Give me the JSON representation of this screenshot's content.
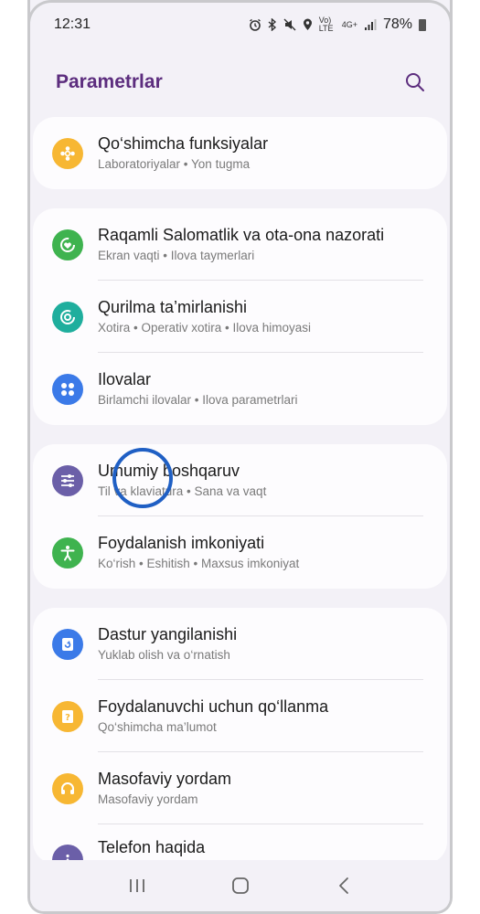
{
  "status_bar": {
    "time": "12:31",
    "network_label": "Vo) LTE",
    "network_type": "4G+",
    "battery_percent": "78%"
  },
  "header": {
    "title": "Parametrlar"
  },
  "groups": [
    {
      "items": [
        {
          "icon": "puzzle-icon",
          "color": "#f7b733",
          "title": "Qo‘shimcha funksiyalar",
          "subtitle": "Laboratoriyalar  •  Yon tugma"
        }
      ]
    },
    {
      "items": [
        {
          "icon": "heart-icon",
          "color": "#3fb34f",
          "title": "Raqamli Salomatlik va ota-ona nazorati",
          "subtitle": "Ekran vaqti  •  Ilova taymerlari"
        },
        {
          "icon": "device-care-icon",
          "color": "#1fae9d",
          "title": "Qurilma ta’mirlanishi",
          "subtitle": "Xotira  •  Operativ xotira  •  Ilova himoyasi"
        },
        {
          "icon": "apps-icon",
          "color": "#3b7ae8",
          "title": "Ilovalar",
          "subtitle": "Birlamchi ilovalar  •  Ilova parametrlari"
        }
      ]
    },
    {
      "items": [
        {
          "icon": "sliders-icon",
          "color": "#6b5fa8",
          "title": "Umumiy boshqaruv",
          "subtitle": "Til va klaviatura  •  Sana va vaqt"
        },
        {
          "icon": "accessibility-icon",
          "color": "#3fb34f",
          "title": "Foydalanish imkoniyati",
          "subtitle": "Ko‘rish  •  Eshitish  •  Maxsus imkoniyat"
        }
      ]
    },
    {
      "items": [
        {
          "icon": "update-icon",
          "color": "#3b7ae8",
          "title": "Dastur yangilanishi",
          "subtitle": "Yuklab olish va o‘rnatish"
        },
        {
          "icon": "manual-icon",
          "color": "#f7b733",
          "title": "Foydalanuvchi uchun qo‘llanma",
          "subtitle": "Qo‘shimcha ma’lumot"
        },
        {
          "icon": "headset-icon",
          "color": "#f7b733",
          "title": "Masofaviy yordam",
          "subtitle": "Masofaviy yordam"
        },
        {
          "icon": "info-icon",
          "color": "#6b5fa8",
          "title": "Telefon haqida",
          "subtitle": ""
        }
      ]
    }
  ]
}
